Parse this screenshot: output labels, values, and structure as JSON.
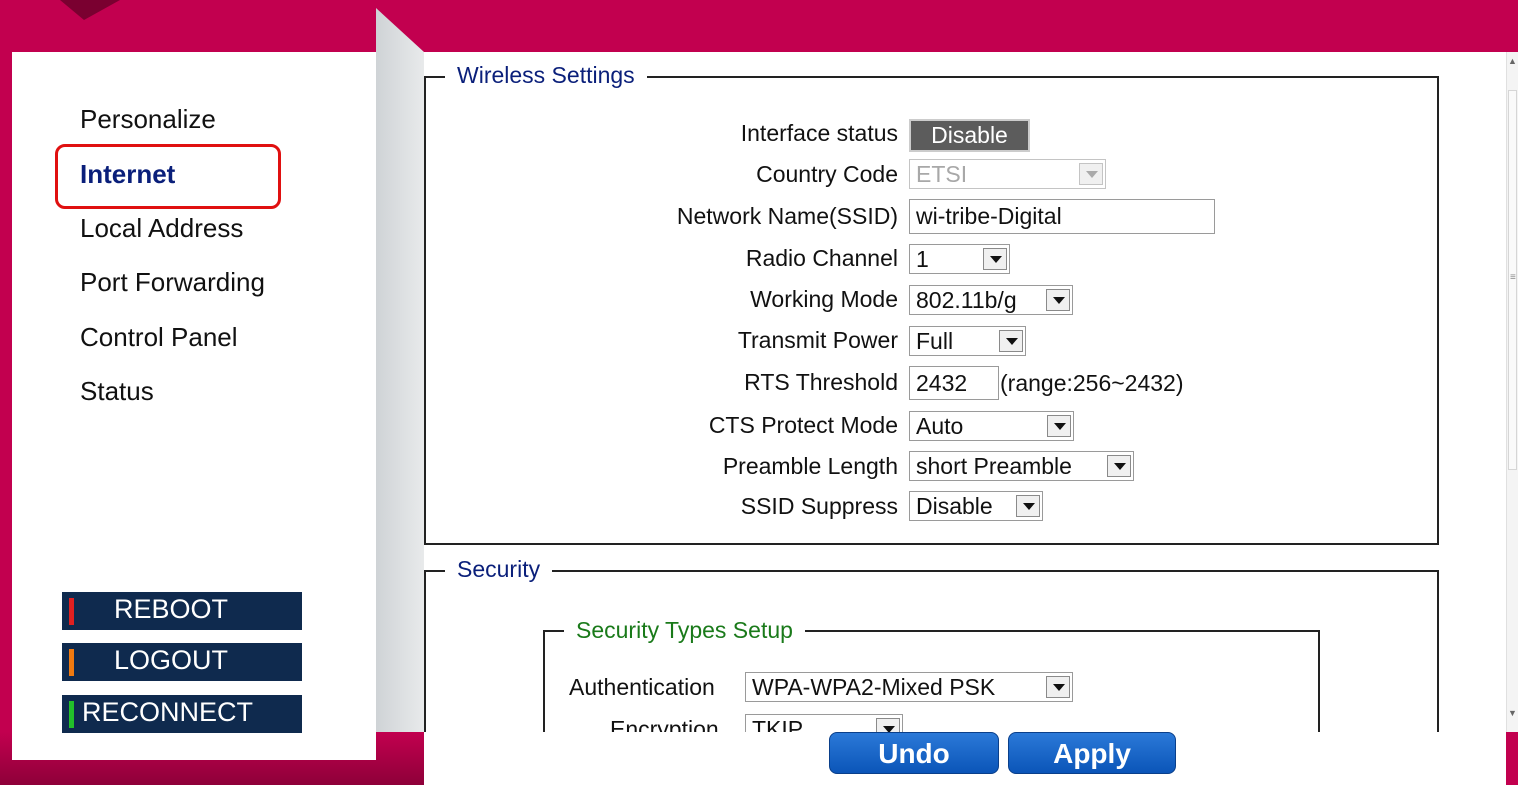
{
  "nav": {
    "items": [
      {
        "label": "Personalize",
        "active": false
      },
      {
        "label": "Internet",
        "active": true
      },
      {
        "label": "Local Address",
        "active": false
      },
      {
        "label": "Port Forwarding",
        "active": false
      },
      {
        "label": "Control Panel",
        "active": false
      },
      {
        "label": "Status",
        "active": false
      }
    ]
  },
  "side_buttons": {
    "reboot": "REBOOT",
    "logout": "LOGOUT",
    "reconnect": "RECONNECT"
  },
  "wireless": {
    "legend": "Wireless Settings",
    "interface_status": {
      "label": "Interface status",
      "button": "Disable"
    },
    "country_code": {
      "label": "Country Code",
      "value": "ETSI"
    },
    "ssid": {
      "label": "Network Name(SSID)",
      "value": "wi-tribe-Digital"
    },
    "radio_channel": {
      "label": "Radio Channel",
      "value": "1"
    },
    "working_mode": {
      "label": "Working Mode",
      "value": "802.11b/g"
    },
    "transmit_power": {
      "label": "Transmit Power",
      "value": "Full"
    },
    "rts_threshold": {
      "label": "RTS Threshold",
      "value": "2432",
      "hint": "(range:256~2432)"
    },
    "cts_protect": {
      "label": "CTS Protect Mode",
      "value": "Auto"
    },
    "preamble": {
      "label": "Preamble Length",
      "value": "short Preamble"
    },
    "ssid_suppress": {
      "label": "SSID Suppress",
      "value": "Disable"
    }
  },
  "security": {
    "legend": "Security",
    "types_legend": "Security Types Setup",
    "authentication": {
      "label": "Authentication",
      "value": "WPA-WPA2-Mixed PSK"
    },
    "encryption": {
      "label": "Encryption",
      "value": "TKIP"
    }
  },
  "actions": {
    "undo": "Undo",
    "apply": "Apply"
  },
  "colors": {
    "brand": "#c2004f",
    "nav_active": "#0a1f7a",
    "button_dark": "#0f2a4e",
    "action_blue": "#0b55b8"
  }
}
